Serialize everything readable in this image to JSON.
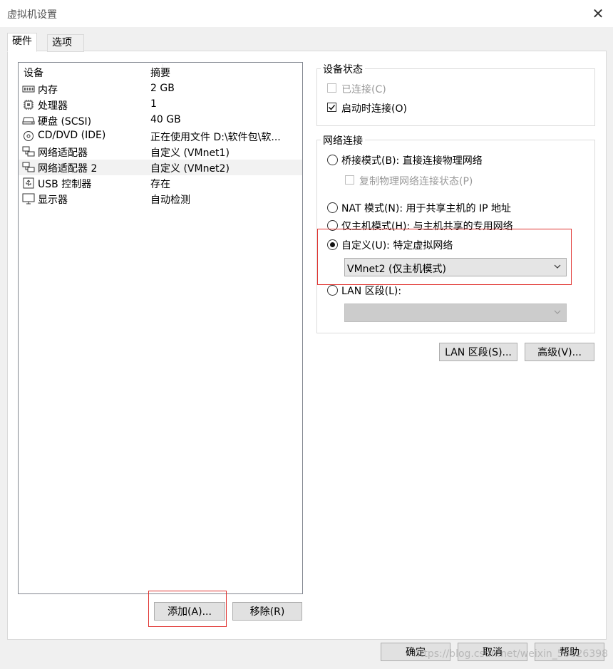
{
  "window": {
    "title": "虚拟机设置",
    "close_glyph": "✕"
  },
  "tabs": [
    {
      "label": "硬件",
      "active": true
    },
    {
      "label": "选项",
      "active": false
    }
  ],
  "device_list": {
    "columns": [
      "设备",
      "摘要"
    ],
    "rows": [
      {
        "name": "内存",
        "summary": "2 GB",
        "icon": "memory-icon"
      },
      {
        "name": "处理器",
        "summary": "1",
        "icon": "processor-icon"
      },
      {
        "name": "硬盘 (SCSI)",
        "summary": "40 GB",
        "icon": "hard-disk-icon"
      },
      {
        "name": "CD/DVD (IDE)",
        "summary": "正在使用文件 D:\\软件包\\软...",
        "icon": "cd-dvd-icon"
      },
      {
        "name": "网络适配器",
        "summary": "自定义 (VMnet1)",
        "icon": "network-adapter-icon"
      },
      {
        "name": "网络适配器 2",
        "summary": "自定义 (VMnet2)",
        "icon": "network-adapter-icon",
        "selected": true
      },
      {
        "name": "USB 控制器",
        "summary": "存在",
        "icon": "usb-controller-icon"
      },
      {
        "name": "显示器",
        "summary": "自动检测",
        "icon": "display-icon"
      }
    ]
  },
  "list_buttons": {
    "add": "添加(A)...",
    "remove": "移除(R)"
  },
  "device_status": {
    "title": "设备状态",
    "connected": {
      "label": "已连接(C)",
      "checked": false,
      "enabled": false
    },
    "connect_on_power": {
      "label": "启动时连接(O)",
      "checked": true
    }
  },
  "network_connection": {
    "title": "网络连接",
    "bridged": {
      "label": "桥接模式(B): 直接连接物理网络",
      "selected": false
    },
    "replicate": {
      "label": "复制物理网络连接状态(P)",
      "checked": false,
      "enabled": false
    },
    "nat": {
      "label": "NAT 模式(N): 用于共享主机的 IP 地址",
      "selected": false
    },
    "host_only": {
      "label": "仅主机模式(H): 与主机共享的专用网络",
      "selected": false
    },
    "custom": {
      "label": "自定义(U): 特定虚拟网络",
      "selected": true,
      "value": "VMnet2 (仅主机模式)"
    },
    "lan_segment": {
      "label": "LAN 区段(L):",
      "selected": false,
      "value": ""
    }
  },
  "network_buttons": {
    "lan_segments": "LAN 区段(S)...",
    "advanced": "高级(V)..."
  },
  "footer_buttons": {
    "ok": "确定",
    "cancel": "取消",
    "help": "帮助"
  },
  "watermark": "https://blog.csdn.net/weixin_50626398",
  "colors": {
    "highlight_box": "#e0322f",
    "selected_row": "#f2f2f2"
  }
}
